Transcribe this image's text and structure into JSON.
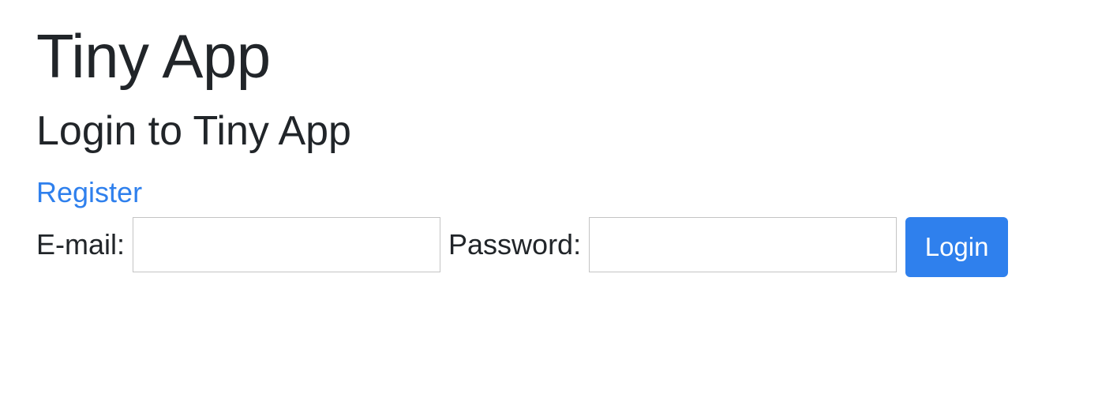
{
  "header": {
    "app_title": "Tiny App"
  },
  "main": {
    "heading": "Login to Tiny App",
    "register_link": "Register",
    "form": {
      "email_label": "E-mail:",
      "email_value": "",
      "password_label": "Password:",
      "password_value": "",
      "submit_label": "Login"
    }
  },
  "colors": {
    "link": "#2f80ed",
    "button": "#2f80ed",
    "text": "#212529",
    "input_border": "#c4c4c4"
  }
}
